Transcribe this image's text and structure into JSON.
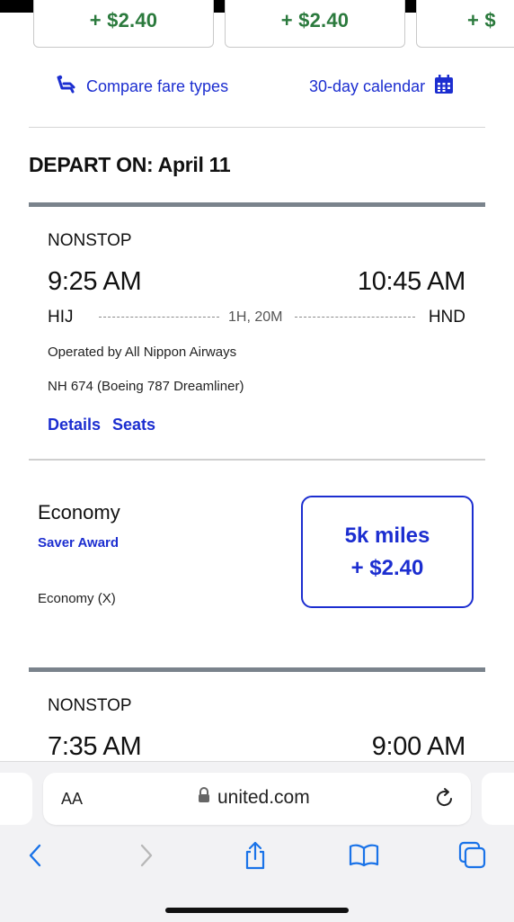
{
  "fare_chips": [
    "+ $2.40",
    "+ $2.40",
    "+ $"
  ],
  "links": {
    "compare": "Compare fare types",
    "calendar": "30-day calendar"
  },
  "depart_title": "DEPART ON: April 11",
  "flights": [
    {
      "stops": "NONSTOP",
      "depart_time": "9:25 AM",
      "arrive_time": "10:45 AM",
      "origin": "HIJ",
      "destination": "HND",
      "duration": "1H, 20M",
      "operator": "Operated by All Nippon Airways",
      "flight_info": "NH 674 (Boeing 787 Dreamliner)",
      "details_label": "Details",
      "seats_label": "Seats",
      "fare": {
        "cabin": "Economy",
        "fare_type": "Saver Award",
        "fare_code": "Economy (X)",
        "miles": "5k miles",
        "cash": "+ $2.40"
      }
    },
    {
      "stops": "NONSTOP",
      "depart_time": "7:35 AM",
      "arrive_time": "9:00 AM"
    }
  ],
  "browser": {
    "text_size_label": "AA",
    "url": "united.com"
  },
  "colors": {
    "link_blue": "#1c2ed0",
    "price_green": "#2b7a3d",
    "divider_gray": "#7a838c"
  }
}
